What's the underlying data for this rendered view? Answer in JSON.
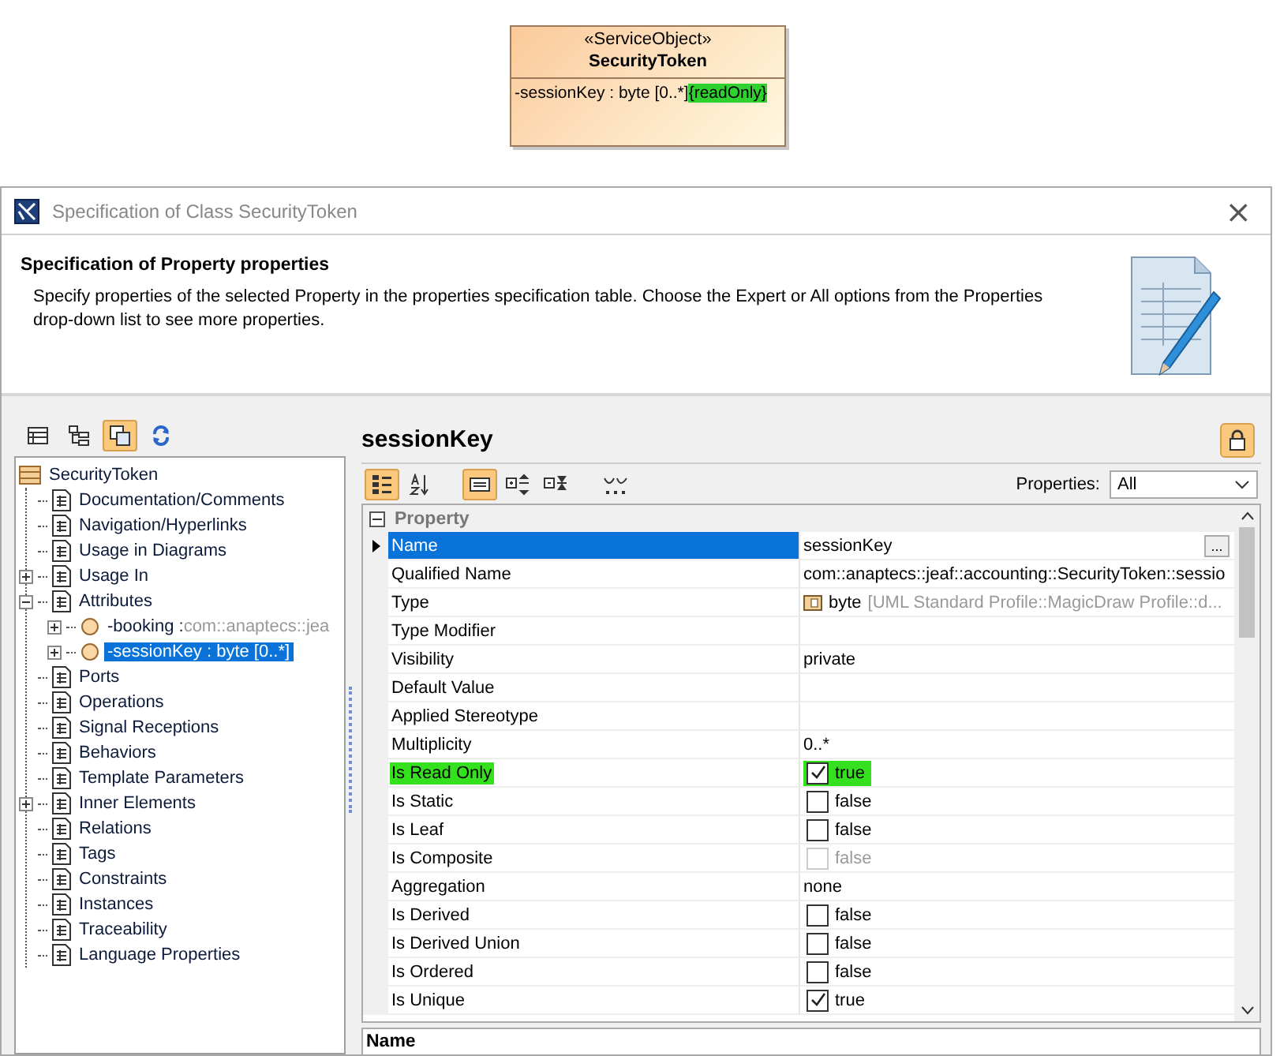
{
  "diagram": {
    "stereotype": "«ServiceObject»",
    "name": "SecurityToken",
    "attribute": "-sessionKey : byte [0..*]",
    "constraint": "{readOnly}",
    "constraint_highlighted": true
  },
  "window": {
    "title": "Specification of Class SecurityToken",
    "close": "×"
  },
  "header": {
    "title": "Specification of Property properties",
    "description": "Specify properties of the selected Property in the properties specification table. Choose the Expert or All options from the Properties drop-down list to see more properties."
  },
  "tree_toolbar": [
    {
      "selected": false
    },
    {
      "selected": false
    },
    {
      "selected": true
    },
    {
      "selected": false
    }
  ],
  "tree": {
    "root": "SecurityToken",
    "items": [
      {
        "label": "Documentation/Comments",
        "selected": false
      },
      {
        "label": "Navigation/Hyperlinks",
        "selected": false
      },
      {
        "label": "Usage in Diagrams",
        "selected": false
      },
      {
        "label": "Usage In",
        "selected": false,
        "expanded": false
      },
      {
        "label": "Attributes",
        "selected": false,
        "expanded": true,
        "children": [
          {
            "label": "-booking :",
            "detail": "com::anaptecs::jea",
            "selected": false,
            "expanded": false
          },
          {
            "label": "-sessionKey : byte [0..*]",
            "selected": true,
            "expanded": false
          }
        ]
      },
      {
        "label": "Ports",
        "selected": false
      },
      {
        "label": "Operations",
        "selected": false
      },
      {
        "label": "Signal Receptions",
        "selected": false
      },
      {
        "label": "Behaviors",
        "selected": false
      },
      {
        "label": "Template Parameters",
        "selected": false
      },
      {
        "label": "Inner Elements",
        "selected": false,
        "expanded": false
      },
      {
        "label": "Relations",
        "selected": false
      },
      {
        "label": "Tags",
        "selected": false
      },
      {
        "label": "Constraints",
        "selected": false
      },
      {
        "label": "Instances",
        "selected": false
      },
      {
        "label": "Traceability",
        "selected": false
      },
      {
        "label": "Language Properties",
        "selected": false
      }
    ]
  },
  "panel": {
    "title": "sessionKey",
    "toolbar": [
      {
        "selected": true
      },
      {
        "selected": false
      },
      {
        "selected": true
      },
      {
        "selected": false
      },
      {
        "selected": false
      },
      {
        "selected": false
      }
    ],
    "properties_label": "Properties:",
    "properties_value": "All"
  },
  "table": {
    "group": "Property",
    "group_expanded": true,
    "rows": [
      {
        "name": "Name",
        "kind": "text",
        "value": "sessionKey",
        "button": "...",
        "selected": true,
        "highlighted": false
      },
      {
        "name": "Qualified Name",
        "kind": "text",
        "value": "com::anaptecs::jeaf::accounting::SecurityToken::sessio",
        "selected": false,
        "highlighted": false
      },
      {
        "name": "Type",
        "kind": "type",
        "value": "byte",
        "detail": "[UML Standard Profile::MagicDraw Profile::d...",
        "selected": false,
        "highlighted": false
      },
      {
        "name": "Type Modifier",
        "kind": "text",
        "selected": false,
        "highlighted": false
      },
      {
        "name": "Visibility",
        "kind": "text",
        "value": "private",
        "selected": false,
        "highlighted": false
      },
      {
        "name": "Default Value",
        "kind": "text",
        "selected": false,
        "highlighted": false
      },
      {
        "name": "Applied Stereotype",
        "kind": "text",
        "selected": false,
        "highlighted": false
      },
      {
        "name": "Multiplicity",
        "kind": "text",
        "value": "0..*",
        "selected": false,
        "highlighted": false
      },
      {
        "name": "Is Read Only",
        "kind": "checkbox",
        "value": "true",
        "checked": true,
        "disabled": false,
        "selected": false,
        "highlighted": true
      },
      {
        "name": "Is Static",
        "kind": "checkbox",
        "value": "false",
        "checked": false,
        "disabled": false,
        "selected": false,
        "highlighted": false
      },
      {
        "name": "Is Leaf",
        "kind": "checkbox",
        "value": "false",
        "checked": false,
        "disabled": false,
        "selected": false,
        "highlighted": false
      },
      {
        "name": "Is Composite",
        "kind": "checkbox",
        "value": "false",
        "checked": false,
        "disabled": true,
        "selected": false,
        "highlighted": false
      },
      {
        "name": "Aggregation",
        "kind": "text",
        "value": "none",
        "selected": false,
        "highlighted": false
      },
      {
        "name": "Is Derived",
        "kind": "checkbox",
        "value": "false",
        "checked": false,
        "disabled": false,
        "selected": false,
        "highlighted": false
      },
      {
        "name": "Is Derived Union",
        "kind": "checkbox",
        "value": "false",
        "checked": false,
        "disabled": false,
        "selected": false,
        "highlighted": false
      },
      {
        "name": "Is Ordered",
        "kind": "checkbox",
        "value": "false",
        "checked": false,
        "disabled": false,
        "selected": false,
        "highlighted": false
      },
      {
        "name": "Is Unique",
        "kind": "checkbox",
        "value": "true",
        "checked": true,
        "disabled": false,
        "selected": false,
        "highlighted": false
      }
    ]
  },
  "bottom_panel": {
    "title": "Name"
  }
}
